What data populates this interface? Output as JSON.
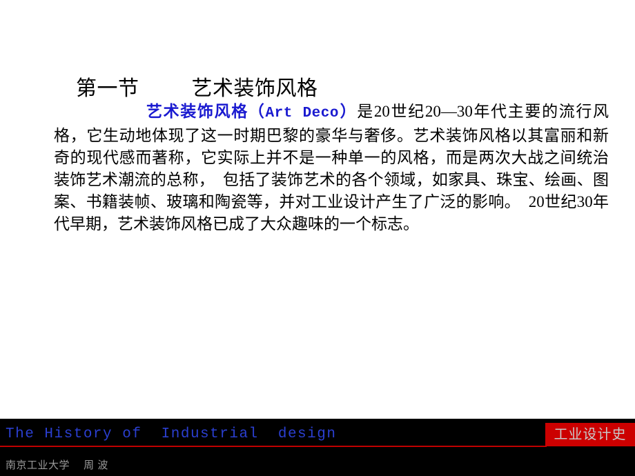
{
  "slide": {
    "background_color": "#ffffff",
    "title": {
      "section_label": "第一节",
      "section_name": "艺术装饰风格",
      "color": "#000000"
    },
    "body": {
      "accent_text": "艺术装饰风格（",
      "accent_latin": "Art Deco",
      "accent_text_close": "）",
      "accent_color": "#1a1ad0",
      "text": "是20世纪20—30年代主要的流行风格，它生动地体现了这一时期巴黎的豪华与奢侈。艺术装饰风格以其富丽和新奇的现代感而著称，它实际上并不是一种单一的风格，而是两次大战之间统治装饰艺术潮流的总称，　包括了装饰艺术的各个领域，如家具、珠宝、绘画、图案、书籍装帧、玻璃和陶瓷等，并对工业设计产生了广泛的影响。　20世纪30年代早期，艺术装饰风格已成了大众趣味的一个标志。",
      "color": "#000000"
    }
  },
  "footer": {
    "background_color": "#000000",
    "course_title_en": "The History of  Industrial  design",
    "course_title_color": "#2b3fd0",
    "rule_color": "#c00000",
    "badge_label": "工业设计史",
    "badge_background": "#cc0000",
    "badge_text_color": "#c9c9c9",
    "author_line": "南京工业大学　 周 波",
    "author_color": "#9a9a9a"
  }
}
